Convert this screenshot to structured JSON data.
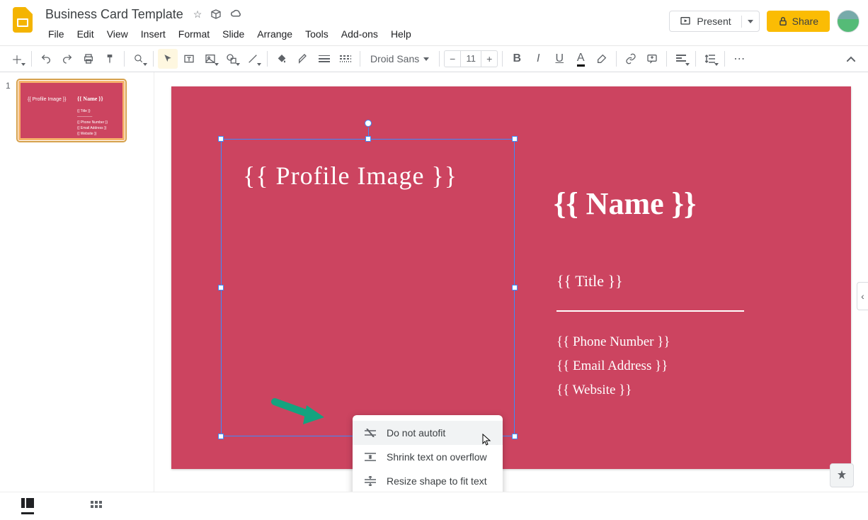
{
  "app": {
    "name": "Google Slides"
  },
  "doc": {
    "title": "Business Card Template"
  },
  "menus": [
    "File",
    "Edit",
    "View",
    "Insert",
    "Format",
    "Slide",
    "Arrange",
    "Tools",
    "Add-ons",
    "Help"
  ],
  "controls": {
    "present": "Present",
    "share": "Share"
  },
  "toolbar": {
    "font": "Droid Sans",
    "font_size": "11"
  },
  "slide": {
    "number": "1",
    "bg_color": "#cc4460",
    "profile_image": "{{ Profile Image }}",
    "name": "{{ Name }}",
    "title": "{{ Title }}",
    "phone": "{{ Phone Number }}",
    "email": "{{ Email Address }}",
    "website": "{{ Website }}"
  },
  "autofit": {
    "opt1": "Do not autofit",
    "opt2": "Shrink text on overflow",
    "opt3": "Resize shape to fit text"
  }
}
